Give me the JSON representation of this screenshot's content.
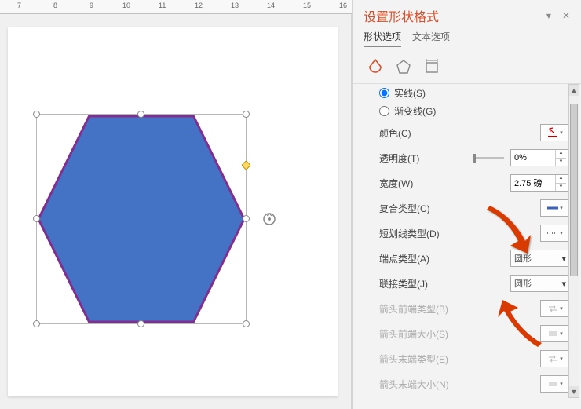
{
  "ruler": {
    "marks": [
      7,
      8,
      9,
      10,
      11,
      12,
      13,
      14,
      15,
      16
    ]
  },
  "panel": {
    "title": "设置形状格式",
    "tabs": {
      "shape": "形状选项",
      "text": "文本选项"
    },
    "radios": {
      "solid": "实线(S)",
      "gradient": "渐变线(G)"
    },
    "props": {
      "color": "颜色(C)",
      "transparency": "透明度(T)",
      "width": "宽度(W)",
      "compound": "复合类型(C)",
      "dash": "短划线类型(D)",
      "cap": "端点类型(A)",
      "join": "联接类型(J)",
      "beginType": "箭头前端类型(B)",
      "beginSize": "箭头前端大小(S)",
      "endType": "箭头末端类型(E)",
      "endSize": "箭头末端大小(N)"
    },
    "values": {
      "transparency": "0%",
      "width": "2.75 磅",
      "cap": "圆形",
      "join": "圆形"
    }
  },
  "colors": {
    "shapeFill": "#4472c4",
    "shapeStroke": "#812f8f",
    "accent": "#d94f2b"
  }
}
